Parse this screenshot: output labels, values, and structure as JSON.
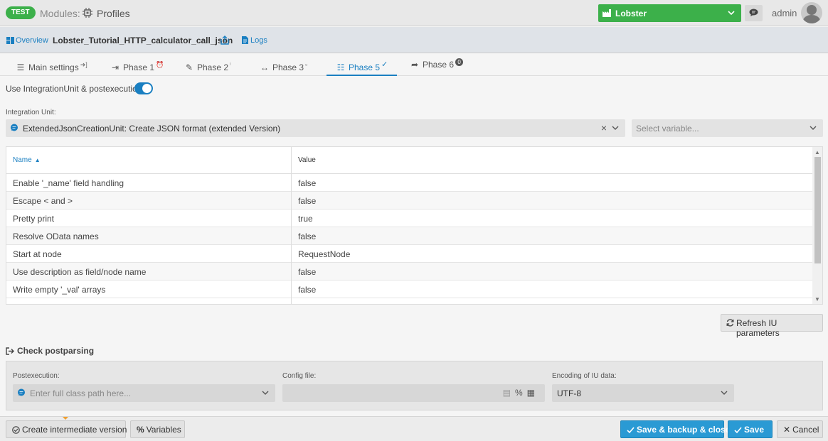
{
  "header": {
    "env_badge": "TEST",
    "modules_label": "Modules:",
    "profiles_label": "Profiles",
    "partner_select": "Lobster",
    "user": "admin"
  },
  "subheader": {
    "overview": "Overview",
    "profile_name": "Lobster_Tutorial_HTTP_calculator_call_json",
    "logs": "Logs"
  },
  "tabs": [
    {
      "label": "Main settings"
    },
    {
      "label": "Phase 1"
    },
    {
      "label": "Phase 2"
    },
    {
      "label": "Phase 3"
    },
    {
      "label": "Phase 5",
      "active": true
    },
    {
      "label": "Phase 6",
      "badge": "0"
    }
  ],
  "integration": {
    "use_label": "Use IntegrationUnit & postexecution",
    "use_enabled": true,
    "unit_label": "Integration Unit:",
    "unit_value": "ExtendedJsonCreationUnit: Create JSON format (extended Version)",
    "variable_placeholder": "Select variable..."
  },
  "params_table": {
    "columns": [
      "Name",
      "Value"
    ],
    "rows": [
      {
        "name": "Enable '_name' field handling",
        "value": "false"
      },
      {
        "name": "Escape < and >",
        "value": "false"
      },
      {
        "name": "Pretty print",
        "value": "true"
      },
      {
        "name": "Resolve OData names",
        "value": "false"
      },
      {
        "name": "Start at node",
        "value": "RequestNode"
      },
      {
        "name": "Use description as field/node name",
        "value": "false"
      },
      {
        "name": "Write empty '_val' arrays",
        "value": "false"
      }
    ]
  },
  "refresh_button": "Refresh IU parameters",
  "postparsing": {
    "title": "Check postparsing",
    "postexecution_label": "Postexecution:",
    "postexecution_placeholder": "Enter full class path here...",
    "config_label": "Config file:",
    "encoding_label": "Encoding of IU data:",
    "encoding_value": "UTF-8"
  },
  "footer": {
    "create_version": "Create intermediate version",
    "variables": "Variables",
    "save_backup_close": "Save & backup & close",
    "save": "Save",
    "cancel": "Cancel"
  },
  "colors": {
    "accent": "#1a7fc1",
    "green": "#3cb04a",
    "button_blue": "#2a9ad4"
  }
}
